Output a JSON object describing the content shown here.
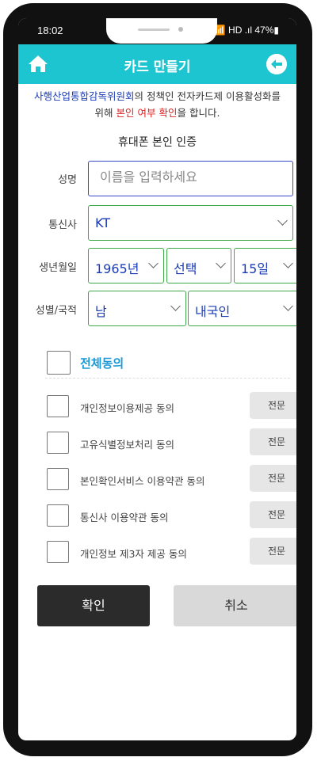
{
  "status_bar": {
    "time": "18:02",
    "right": "📶 HD .ıl 47%▮"
  },
  "app_bar": {
    "title": "카드 만들기"
  },
  "notice": {
    "org": "사행산업통합감독위원회",
    "text1": "의 정책인 전자카드제 이용활성화를",
    "text2": "위해 ",
    "highlight": "본인 여부 확인",
    "text3": "을 합니다."
  },
  "section_title": "휴대폰 본인 인증",
  "form": {
    "name_label": "성명",
    "name_placeholder": "이름을 입력하세요",
    "carrier_label": "통신사",
    "carrier_value": "KT",
    "birth_label": "생년월일",
    "birth_year": "1965년",
    "birth_month": "선택",
    "birth_day": "15일",
    "gender_label": "성별/국적",
    "gender_value": "남",
    "nationality_value": "내국인"
  },
  "agreements": {
    "all_label": "전체동의",
    "full_label": "전문",
    "items": [
      "개인정보이용제공 동의",
      "고유식별정보처리 동의",
      "본인확인서비스 이용약관 동의",
      "통신사 이용약관 동의",
      "개인정보 제3자 제공 동의"
    ]
  },
  "buttons": {
    "confirm": "확인",
    "cancel": "취소"
  }
}
